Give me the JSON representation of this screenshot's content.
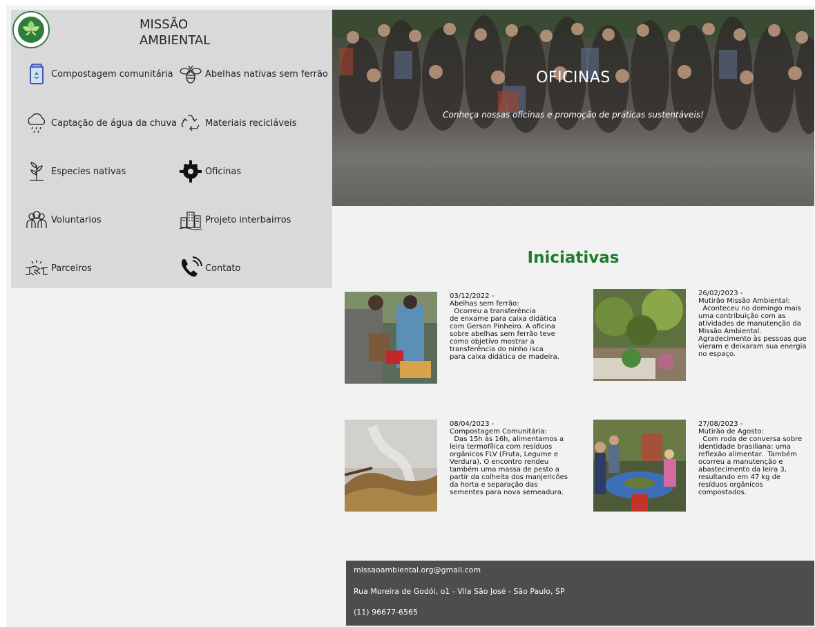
{
  "brand": {
    "name_line1": "MISSÃO",
    "name_line2": "AMBIENTAL"
  },
  "menu": [
    {
      "label": "Compostagem comunitária",
      "icon": "compost-bin-icon"
    },
    {
      "label": "Abelhas nativas sem ferrão",
      "icon": "bee-icon"
    },
    {
      "label": "Captação de água da chuva",
      "icon": "rain-cloud-icon"
    },
    {
      "label": "Materiais recicláveis",
      "icon": "recycle-icon"
    },
    {
      "label": "Especies nativas",
      "icon": "plant-icon"
    },
    {
      "label": "Oficinas",
      "icon": "workshop-gear-people-icon"
    },
    {
      "label": "Voluntarios",
      "icon": "volunteers-icon"
    },
    {
      "label": "Projeto interbairros",
      "icon": "city-icon"
    },
    {
      "label": "Parceiros",
      "icon": "handshake-icon"
    },
    {
      "label": "Contato",
      "icon": "phone-icon"
    }
  ],
  "hero": {
    "title": "OFICINAS",
    "subtitle": "Conheça nossas oficinas e promoção de práticas sustentáveis!"
  },
  "iniciativas": {
    "title": "Iniciativas",
    "cards": [
      {
        "date": "03/12/2022 -",
        "heading": "Abelhas sem ferrão:",
        "body": "  Ocorreu a transferência\nde enxame para caixa didática\ncom Gerson Pinheiro. A oficina\nsobre abelhas sem ferrão teve\ncomo objetivo mostrar a\ntransferência do ninho isca\npara caixa didática de madeira."
      },
      {
        "date": "26/02/2023 -",
        "heading": "Mutirão Missão Ambiental:",
        "body": "  Aconteceu no domingo mais\numa contribuição com as\natividades de manutenção da\nMissão Ambiental.\nAgradecimento às pessoas que\nvieram e deixaram sua energia\nno espaço."
      },
      {
        "date": "08/04/2023 -",
        "heading": "Compostagem Comunitária:",
        "body": "  Das 15h às 16h, alimentamos a\nleira termofílica com resíduos\norgânicos FLV (Fruta, Legume e\nVerdura). O encontro rendeu\ntambém uma massa de pesto a\npartir da colheita dos manjericões\nda horta e separação das\nsementes para nova semeadura."
      },
      {
        "date": "27/08/2023 -",
        "heading": "Mutirão de Agosto:",
        "body": "  Com roda de conversa sobre\nidentidade brasiliana: uma\nreflexão alimentar.  Também\nocorreu a manutenção e\nabastecimento da leira 3,\nresultando em 47 kg de\nresíduos orgânicos\ncompostados."
      }
    ]
  },
  "footer": {
    "email": "missaoambiental.org@gmail.com",
    "address": "Rua Moreira de Godói, o1 - Vila São José - São Paulo, SP",
    "phone": "(11) 96677-6565"
  },
  "colors": {
    "accent_green": "#1f7a2d",
    "sidebar_bg": "#d9d9d9",
    "footer_bg": "#4d4d4d",
    "page_bg": "#f2f2f2"
  }
}
